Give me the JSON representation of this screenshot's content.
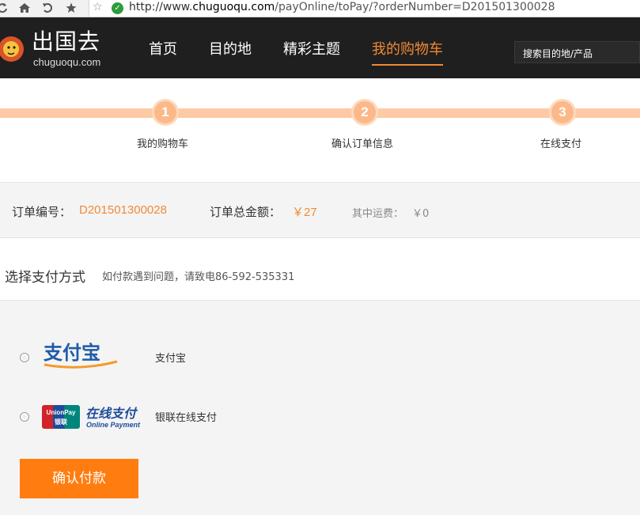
{
  "browser": {
    "url_scheme": "http://www.",
    "url_host": "chuguoqu.com",
    "url_path": "/payOnline/toPay/?orderNumber=D201501300028"
  },
  "header": {
    "logo_text": "出国去",
    "logo_sub": "chuguoqu.com",
    "nav": [
      {
        "label": "首页"
      },
      {
        "label": "目的地"
      },
      {
        "label": "精彩主题"
      },
      {
        "label": "我的购物车"
      }
    ],
    "search_placeholder": "搜索目的地/产品",
    "accent_color": "#f08a37"
  },
  "steps": [
    {
      "num": "1",
      "label": "我的购物车"
    },
    {
      "num": "2",
      "label": "确认订单信息"
    },
    {
      "num": "3",
      "label": "在线支付"
    }
  ],
  "order": {
    "number_label": "订单编号：",
    "number_value": "D201501300028",
    "total_label": "订单总金额：",
    "total_value": "￥27",
    "shipping_label": "其中运费：",
    "shipping_value": "￥0"
  },
  "payment": {
    "title": "选择支付方式",
    "hint": "如付款遇到问题，请致电86-592-535331",
    "options": [
      {
        "logo_text": "支付宝",
        "label": "支付宝"
      },
      {
        "logo_text": "在线支付",
        "logo_sub": "Online Payment",
        "logo_brand": "UnionPay",
        "logo_brand_cn": "银联",
        "label": "银联在线支付"
      }
    ],
    "confirm_label": "确认付款",
    "button_color": "#ff7d10"
  }
}
